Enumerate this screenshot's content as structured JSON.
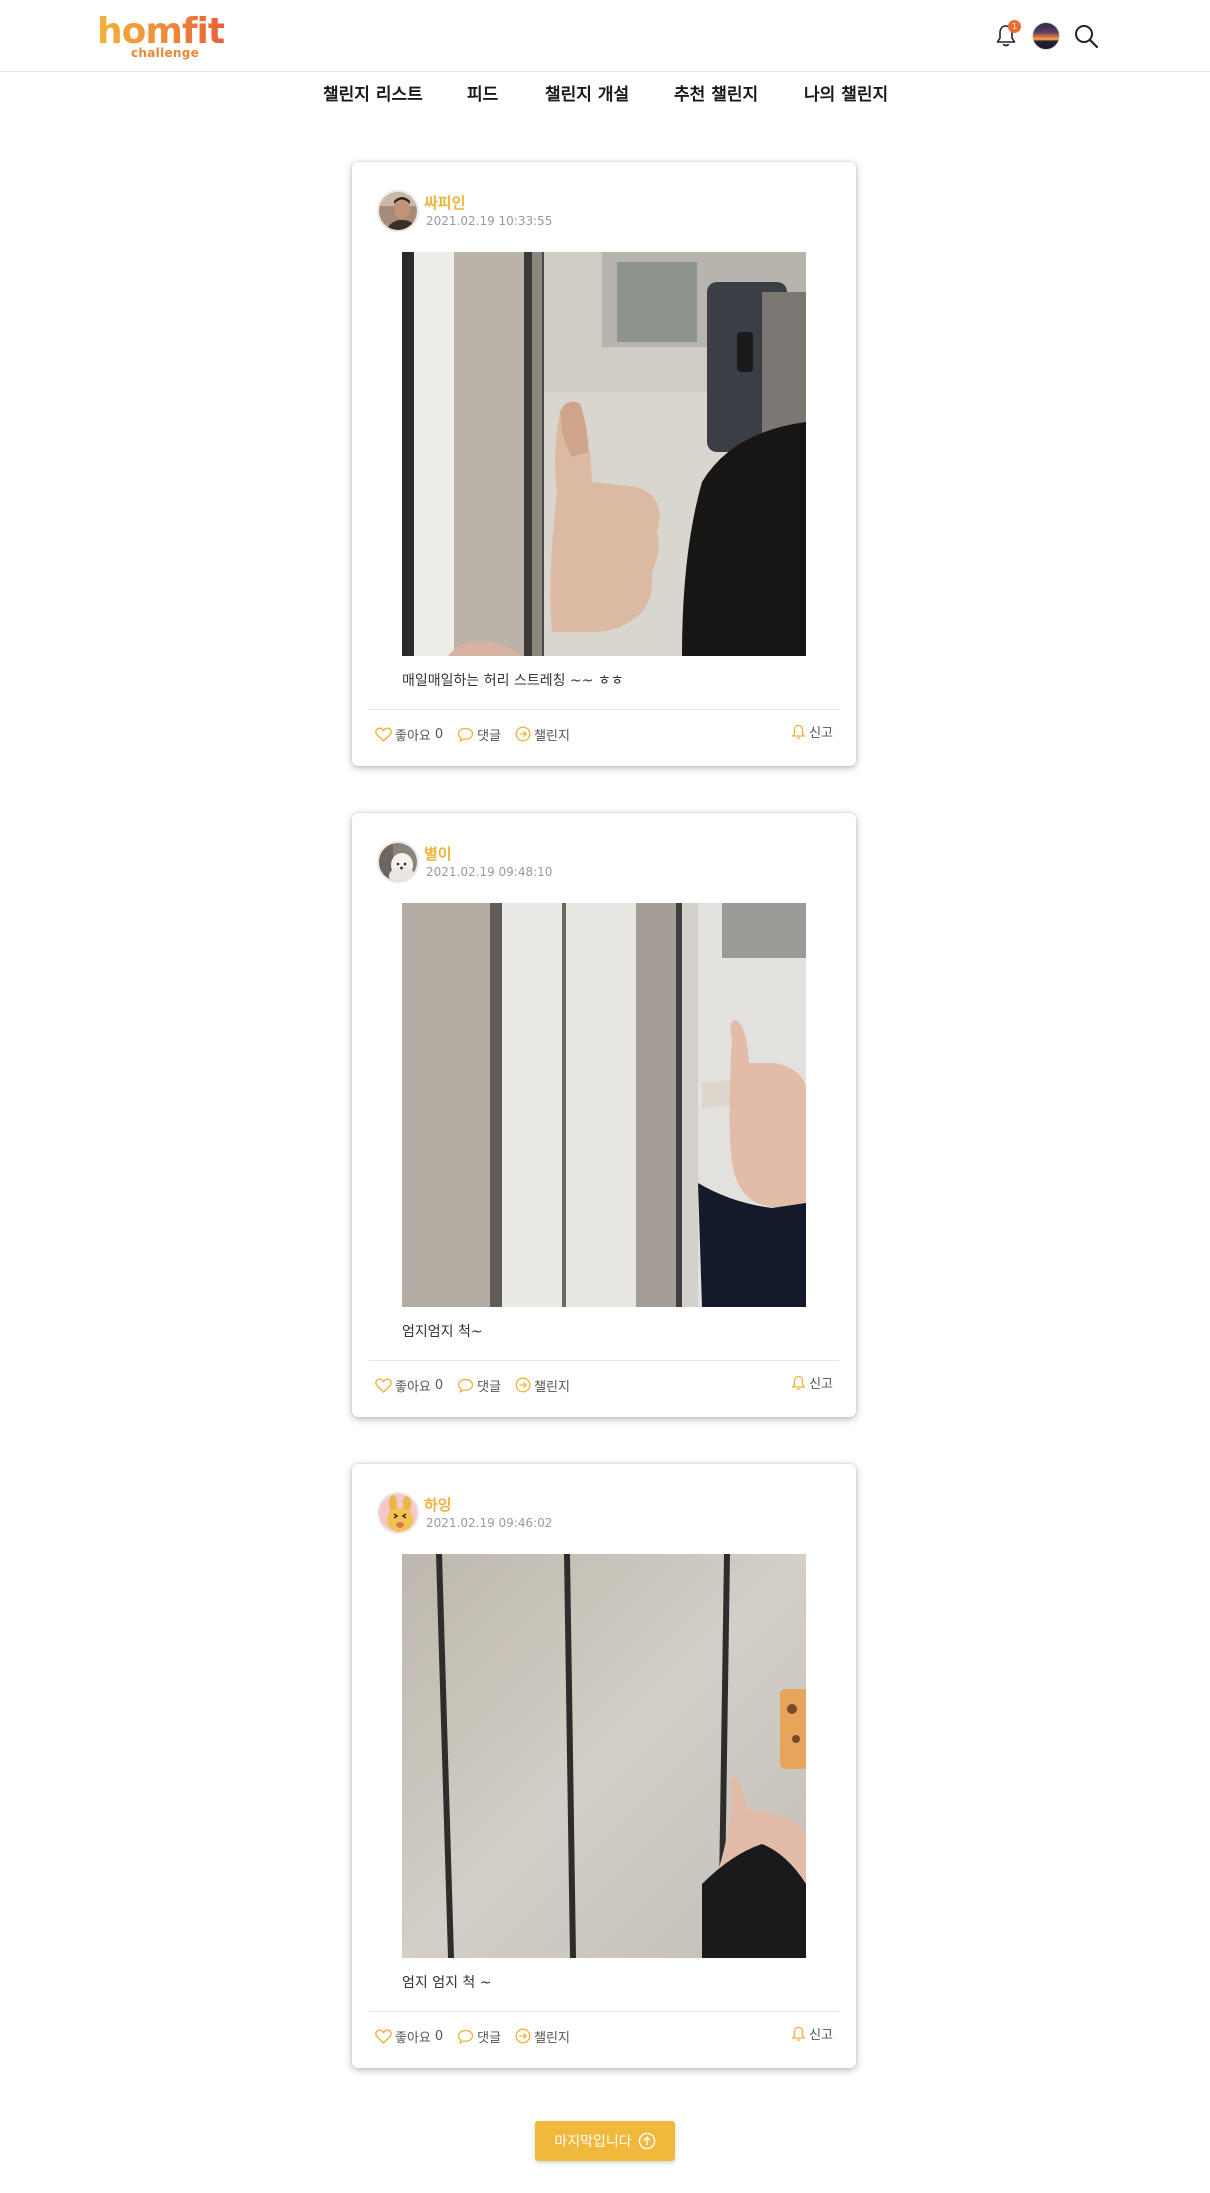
{
  "app": {
    "logo_main": "homfit",
    "logo_sub": "challenge",
    "notification_count": "1"
  },
  "nav": {
    "items": [
      {
        "label": "챌린지 리스트"
      },
      {
        "label": "피드"
      },
      {
        "label": "챌린지 개설"
      },
      {
        "label": "추천 챌린지"
      },
      {
        "label": "나의 챌린지"
      }
    ]
  },
  "posts": [
    {
      "username": "싸피인",
      "timestamp": "2021.02.19 10:33:55",
      "caption": "매일매일하는 허리 스트레칭 ~~ ㅎㅎ",
      "like_label": "좋아요",
      "like_count": "0",
      "comment_label": "댓글",
      "challenge_label": "챌린지",
      "report_label": "신고"
    },
    {
      "username": "별이",
      "timestamp": "2021.02.19 09:48:10",
      "caption": "엄지엄지 척~",
      "like_label": "좋아요",
      "like_count": "0",
      "comment_label": "댓글",
      "challenge_label": "챌린지",
      "report_label": "신고"
    },
    {
      "username": "하잉",
      "timestamp": "2021.02.19 09:46:02",
      "caption": "엄지 엄지 척 ~",
      "like_label": "좋아요",
      "like_count": "0",
      "comment_label": "댓글",
      "challenge_label": "챌린지",
      "report_label": "신고"
    }
  ],
  "footer": {
    "last_button_label": "마지막입니다"
  },
  "colors": {
    "accent": "#efb23a",
    "button": "#f1b93c",
    "badge": "#f06a34"
  },
  "icons": [
    "bell-icon",
    "search-icon",
    "heart-icon",
    "comment-icon",
    "arrow-circle-icon",
    "bell-report-icon",
    "arrow-up-circle-icon"
  ]
}
